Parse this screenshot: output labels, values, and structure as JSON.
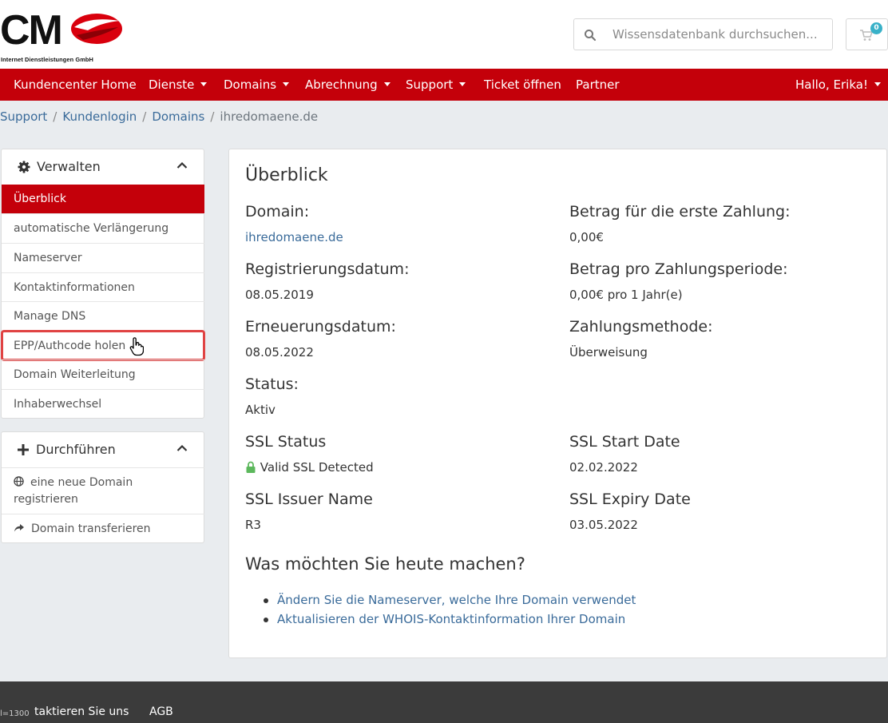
{
  "brand": {
    "logo_text": "CMO",
    "logo_subtitle": "Internet Dienstleistungen GmbH"
  },
  "header": {
    "search_placeholder": "Wissensdatenbank durchsuchen...",
    "cart_count": "0"
  },
  "nav": {
    "items": [
      {
        "label": "Kundencenter Home",
        "dropdown": false
      },
      {
        "label": "Dienste",
        "dropdown": true
      },
      {
        "label": "Domains",
        "dropdown": true
      },
      {
        "label": "Abrechnung",
        "dropdown": true
      },
      {
        "label": "Support",
        "dropdown": true
      },
      {
        "label": "Ticket öffnen",
        "dropdown": false
      },
      {
        "label": "Partner",
        "dropdown": false
      }
    ],
    "user_menu": "Hallo, Erika!"
  },
  "breadcrumb": [
    "Support",
    "Kundenlogin",
    "Domains",
    "ihredomaene.de"
  ],
  "sidebar": {
    "manage": {
      "title": "Verwalten",
      "items": [
        "Überblick",
        "automatische Verlängerung",
        "Nameserver",
        "Kontaktinformationen",
        "Manage DNS",
        "EPP/Authcode holen",
        "Domain Weiterleitung",
        "Inhaberwechsel"
      ],
      "active_item": "Überblick",
      "highlighted_item": "EPP/Authcode holen"
    },
    "actions": {
      "title": "Durchführen",
      "register_line1": "eine neue Domain",
      "register_line2": "registrieren",
      "transfer": "Domain transferieren"
    }
  },
  "main": {
    "title": "Überblick",
    "fields": {
      "domain_label": "Domain:",
      "domain_value": "ihredomaene.de",
      "first_payment_label": "Betrag für die erste Zahlung:",
      "first_payment_value": "0,00€",
      "registration_label": "Registrierungsdatum:",
      "registration_value": "08.05.2019",
      "recurring_label": "Betrag pro Zahlungsperiode:",
      "recurring_value": "0,00€ pro 1 Jahr(e)",
      "renewal_label": "Erneuerungsdatum:",
      "renewal_value": "08.05.2022",
      "payment_method_label": "Zahlungsmethode:",
      "payment_method_value": "Überweisung",
      "status_label": "Status:",
      "status_value": "Aktiv",
      "ssl_status_label": "SSL Status",
      "ssl_status_value": "Valid SSL Detected",
      "ssl_start_label": "SSL Start Date",
      "ssl_start_value": "02.02.2022",
      "ssl_issuer_label": "SSL Issuer Name",
      "ssl_issuer_value": "R3",
      "ssl_expiry_label": "SSL Expiry Date",
      "ssl_expiry_value": "03.05.2022"
    },
    "actions_title": "Was möchten Sie heute machen?",
    "actions": [
      "Ändern Sie die Nameserver, welche Ihre Domain verwendet",
      "Aktualisieren der WHOIS-Kontaktinformation Ihrer Domain"
    ]
  },
  "footer": {
    "tag": "l=1300",
    "contact": "taktieren Sie uns",
    "agb": "AGB"
  },
  "colors": {
    "brand_red": "#c4000a",
    "link_blue": "#3a6b9a",
    "badge_teal": "#39b1c8",
    "ssl_green": "#5cb85c"
  }
}
